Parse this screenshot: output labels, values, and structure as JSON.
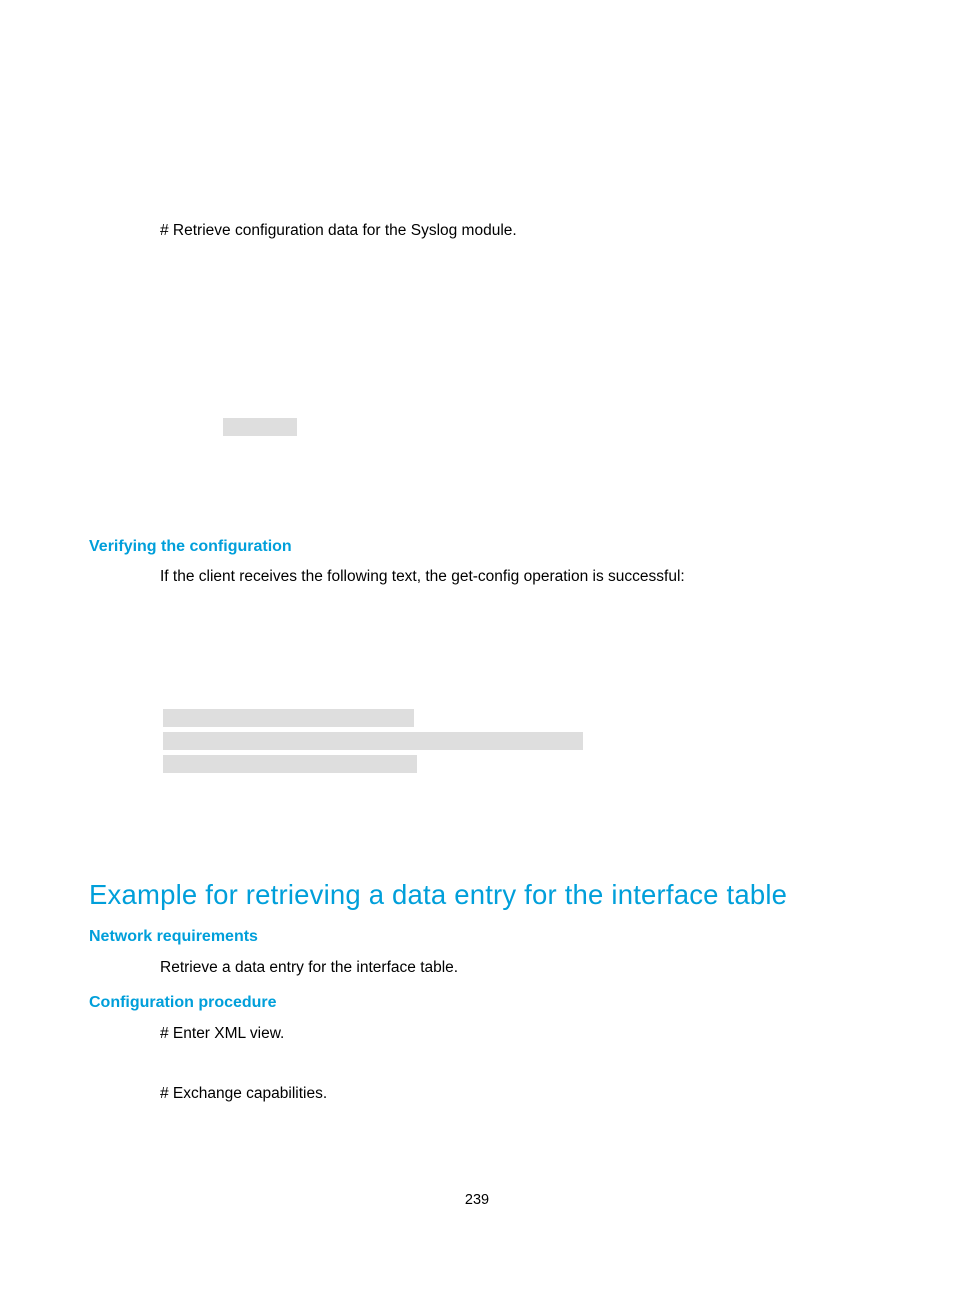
{
  "intro_step_1": "# Retrieve configuration data for the Syslog module.",
  "h_verify": "Verifying the configuration",
  "verify_text": "If the client receives the following text, the get-config operation is successful:",
  "h_example": "Example for retrieving a data entry for the interface table",
  "h_network": "Network requirements",
  "network_text": "Retrieve a data entry for the interface table.",
  "h_config": "Configuration procedure",
  "step_xml": "# Enter XML view.",
  "step_exchange": "# Exchange capabilities.",
  "page_number": "239"
}
